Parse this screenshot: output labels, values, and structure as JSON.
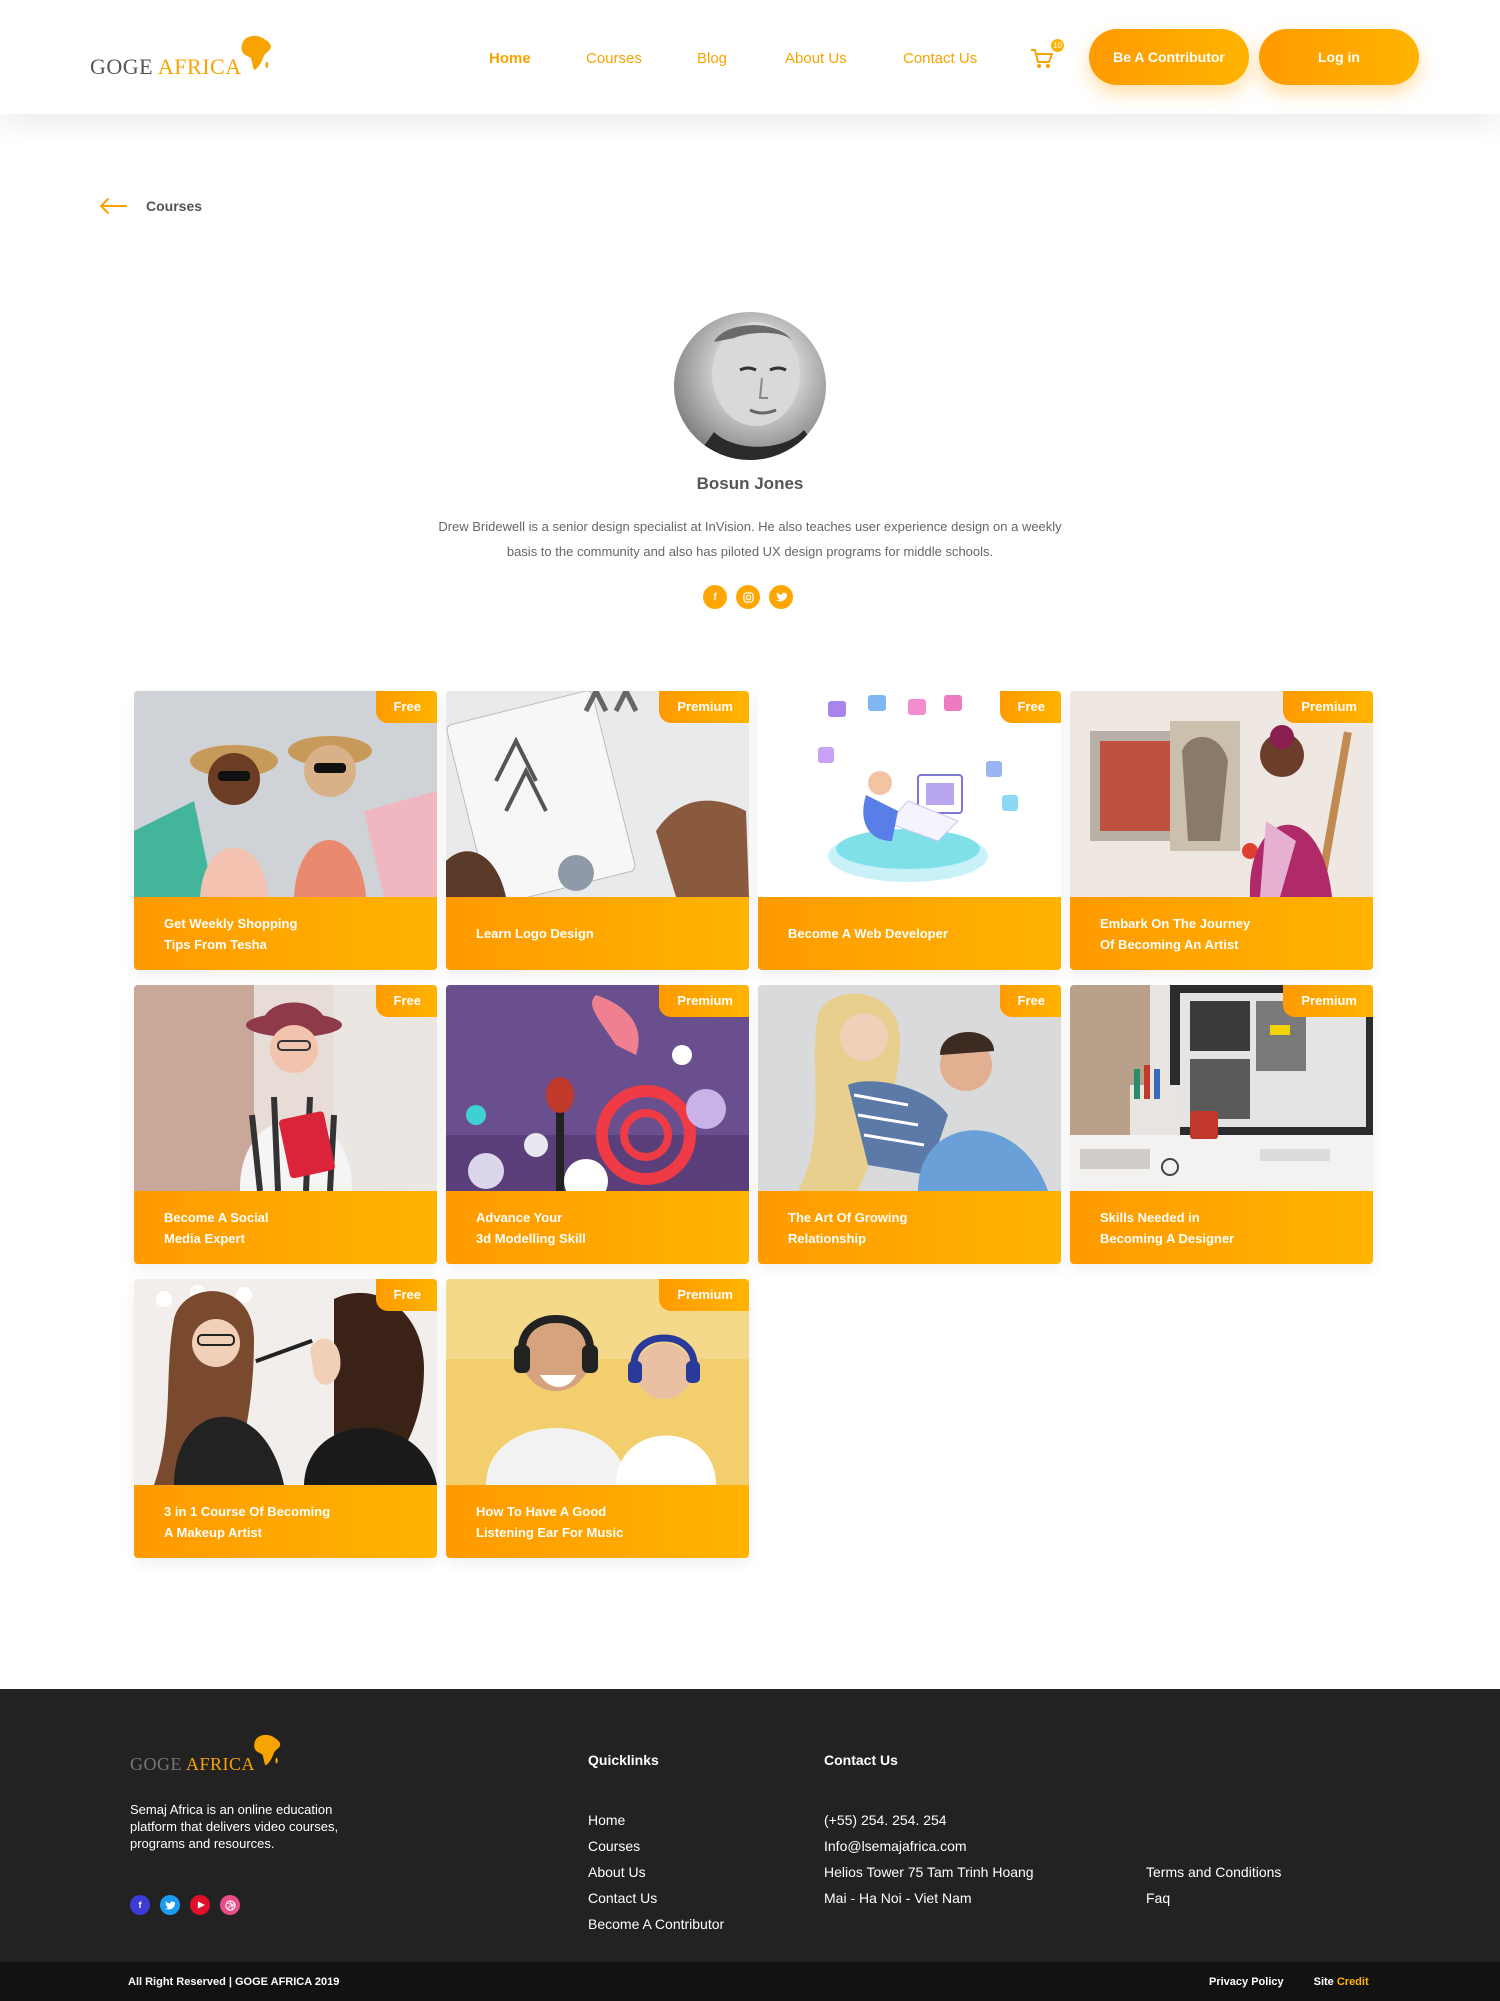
{
  "brand": {
    "name_part1": "GOGE ",
    "name_part2": "AFRICA"
  },
  "nav": {
    "items": [
      {
        "label": "Home",
        "active": true
      },
      {
        "label": "Courses",
        "active": false
      },
      {
        "label": "Blog",
        "active": false
      },
      {
        "label": "About Us",
        "active": false
      },
      {
        "label": "Contact Us",
        "active": false
      }
    ],
    "cart_count": "10",
    "contributor_label": "Be A Contributor",
    "login_label": "Log in"
  },
  "breadcrumb": {
    "label": "Courses"
  },
  "profile": {
    "name": "Bosun Jones",
    "bio": "Drew Bridewell is a senior design specialist at InVision. He also teaches user experience design on a weekly basis to the community and also has piloted UX design programs for middle schools.",
    "social": [
      "facebook-icon",
      "instagram-icon",
      "twitter-icon"
    ]
  },
  "courses": [
    {
      "title": "Get Weekly Shopping\nTips From Tesha",
      "tag": "Free"
    },
    {
      "title": "Learn Logo Design",
      "tag": "Premium"
    },
    {
      "title": "Become A Web Developer",
      "tag": "Free"
    },
    {
      "title": "Embark On The Journey\nOf Becoming An Artist",
      "tag": "Premium"
    },
    {
      "title": "Become A Social\nMedia Expert",
      "tag": "Free"
    },
    {
      "title": "Advance Your\n3d Modelling Skill",
      "tag": "Premium"
    },
    {
      "title": "The Art Of Growing\nRelationship",
      "tag": "Free"
    },
    {
      "title": "Skills Needed in\nBecoming A Designer",
      "tag": "Premium"
    },
    {
      "title": "3 in 1 Course Of Becoming\nA Makeup Artist",
      "tag": "Free"
    },
    {
      "title": "How To Have A Good\nListening Ear For Music",
      "tag": "Premium"
    }
  ],
  "footer": {
    "about": "Semaj Africa is an online education platform that delivers video courses, programs and resources.",
    "social": [
      "facebook-icon",
      "twitter-icon",
      "youtube-icon",
      "dribbble-icon"
    ],
    "quicklinks": {
      "title": "Quicklinks",
      "items": [
        "Home",
        "Courses",
        "About Us",
        "Contact Us",
        "Become A Contributor"
      ]
    },
    "contact": {
      "title": "Contact Us",
      "items": [
        "(+55) 254. 254. 254",
        "Info@lsemajafrica.com",
        "Helios Tower 75 Tam Trinh Hoang",
        "Mai - Ha Noi - Viet Nam"
      ]
    },
    "legal": {
      "items": [
        "Terms and Conditions",
        "Faq"
      ]
    },
    "copyright": "All Right Reserved | GOGE AFRICA 2019",
    "privacy": "Privacy Policy",
    "site_credit_prefix": "Site ",
    "site_credit_link": "Credit"
  },
  "colors": {
    "accent": "#f7a400",
    "accent_light": "#ffb400",
    "footer_bg": "#222222",
    "bottom_bar": "#121212"
  }
}
